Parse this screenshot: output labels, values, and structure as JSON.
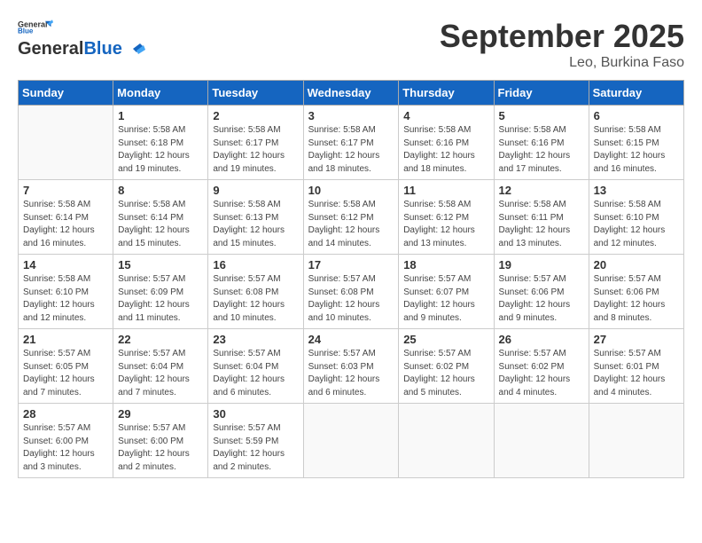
{
  "header": {
    "logo_line1": "General",
    "logo_line2": "Blue",
    "month": "September 2025",
    "location": "Leo, Burkina Faso"
  },
  "days_of_week": [
    "Sunday",
    "Monday",
    "Tuesday",
    "Wednesday",
    "Thursday",
    "Friday",
    "Saturday"
  ],
  "weeks": [
    [
      {
        "day": "",
        "info": ""
      },
      {
        "day": "1",
        "info": "Sunrise: 5:58 AM\nSunset: 6:18 PM\nDaylight: 12 hours\nand 19 minutes."
      },
      {
        "day": "2",
        "info": "Sunrise: 5:58 AM\nSunset: 6:17 PM\nDaylight: 12 hours\nand 19 minutes."
      },
      {
        "day": "3",
        "info": "Sunrise: 5:58 AM\nSunset: 6:17 PM\nDaylight: 12 hours\nand 18 minutes."
      },
      {
        "day": "4",
        "info": "Sunrise: 5:58 AM\nSunset: 6:16 PM\nDaylight: 12 hours\nand 18 minutes."
      },
      {
        "day": "5",
        "info": "Sunrise: 5:58 AM\nSunset: 6:16 PM\nDaylight: 12 hours\nand 17 minutes."
      },
      {
        "day": "6",
        "info": "Sunrise: 5:58 AM\nSunset: 6:15 PM\nDaylight: 12 hours\nand 16 minutes."
      }
    ],
    [
      {
        "day": "7",
        "info": "Sunrise: 5:58 AM\nSunset: 6:14 PM\nDaylight: 12 hours\nand 16 minutes."
      },
      {
        "day": "8",
        "info": "Sunrise: 5:58 AM\nSunset: 6:14 PM\nDaylight: 12 hours\nand 15 minutes."
      },
      {
        "day": "9",
        "info": "Sunrise: 5:58 AM\nSunset: 6:13 PM\nDaylight: 12 hours\nand 15 minutes."
      },
      {
        "day": "10",
        "info": "Sunrise: 5:58 AM\nSunset: 6:12 PM\nDaylight: 12 hours\nand 14 minutes."
      },
      {
        "day": "11",
        "info": "Sunrise: 5:58 AM\nSunset: 6:12 PM\nDaylight: 12 hours\nand 13 minutes."
      },
      {
        "day": "12",
        "info": "Sunrise: 5:58 AM\nSunset: 6:11 PM\nDaylight: 12 hours\nand 13 minutes."
      },
      {
        "day": "13",
        "info": "Sunrise: 5:58 AM\nSunset: 6:10 PM\nDaylight: 12 hours\nand 12 minutes."
      }
    ],
    [
      {
        "day": "14",
        "info": "Sunrise: 5:58 AM\nSunset: 6:10 PM\nDaylight: 12 hours\nand 12 minutes."
      },
      {
        "day": "15",
        "info": "Sunrise: 5:57 AM\nSunset: 6:09 PM\nDaylight: 12 hours\nand 11 minutes."
      },
      {
        "day": "16",
        "info": "Sunrise: 5:57 AM\nSunset: 6:08 PM\nDaylight: 12 hours\nand 10 minutes."
      },
      {
        "day": "17",
        "info": "Sunrise: 5:57 AM\nSunset: 6:08 PM\nDaylight: 12 hours\nand 10 minutes."
      },
      {
        "day": "18",
        "info": "Sunrise: 5:57 AM\nSunset: 6:07 PM\nDaylight: 12 hours\nand 9 minutes."
      },
      {
        "day": "19",
        "info": "Sunrise: 5:57 AM\nSunset: 6:06 PM\nDaylight: 12 hours\nand 9 minutes."
      },
      {
        "day": "20",
        "info": "Sunrise: 5:57 AM\nSunset: 6:06 PM\nDaylight: 12 hours\nand 8 minutes."
      }
    ],
    [
      {
        "day": "21",
        "info": "Sunrise: 5:57 AM\nSunset: 6:05 PM\nDaylight: 12 hours\nand 7 minutes."
      },
      {
        "day": "22",
        "info": "Sunrise: 5:57 AM\nSunset: 6:04 PM\nDaylight: 12 hours\nand 7 minutes."
      },
      {
        "day": "23",
        "info": "Sunrise: 5:57 AM\nSunset: 6:04 PM\nDaylight: 12 hours\nand 6 minutes."
      },
      {
        "day": "24",
        "info": "Sunrise: 5:57 AM\nSunset: 6:03 PM\nDaylight: 12 hours\nand 6 minutes."
      },
      {
        "day": "25",
        "info": "Sunrise: 5:57 AM\nSunset: 6:02 PM\nDaylight: 12 hours\nand 5 minutes."
      },
      {
        "day": "26",
        "info": "Sunrise: 5:57 AM\nSunset: 6:02 PM\nDaylight: 12 hours\nand 4 minutes."
      },
      {
        "day": "27",
        "info": "Sunrise: 5:57 AM\nSunset: 6:01 PM\nDaylight: 12 hours\nand 4 minutes."
      }
    ],
    [
      {
        "day": "28",
        "info": "Sunrise: 5:57 AM\nSunset: 6:00 PM\nDaylight: 12 hours\nand 3 minutes."
      },
      {
        "day": "29",
        "info": "Sunrise: 5:57 AM\nSunset: 6:00 PM\nDaylight: 12 hours\nand 2 minutes."
      },
      {
        "day": "30",
        "info": "Sunrise: 5:57 AM\nSunset: 5:59 PM\nDaylight: 12 hours\nand 2 minutes."
      },
      {
        "day": "",
        "info": ""
      },
      {
        "day": "",
        "info": ""
      },
      {
        "day": "",
        "info": ""
      },
      {
        "day": "",
        "info": ""
      }
    ]
  ]
}
